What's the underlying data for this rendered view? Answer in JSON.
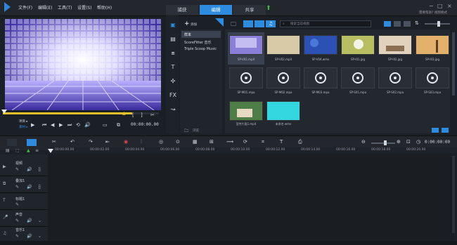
{
  "menu": {
    "file": "文件(F)",
    "edit": "编辑(E)",
    "tools": "工具(T)",
    "settings": "设置(S)",
    "help": "帮助(H)"
  },
  "tabs": [
    "捕获",
    "编辑",
    "共享"
  ],
  "window_info": "需要帮助? 视频格式",
  "preview": {
    "project_label": "项目 ▸",
    "clip_label": "素材 ▸",
    "timecode": "00:00:00.00"
  },
  "library": {
    "add_label": "添加",
    "search_placeholder": "搜索当前视图",
    "categories": [
      "样本",
      "ScoreFitter 音乐",
      "Triple Scoop Music"
    ],
    "browse_label": "浏览",
    "video_thumbs": [
      {
        "caption": "SP-V01.mp4",
        "color": "#8a7fd9"
      },
      {
        "caption": "SP-V02.mp4",
        "color": "#d8c9a7"
      },
      {
        "caption": "SP-V04.wmv",
        "color": "#2b51b5"
      },
      {
        "caption": "SP-I01.jpg",
        "color": "#b7bf62"
      },
      {
        "caption": "SP-I02.jpg",
        "color": "#e0d2bc"
      },
      {
        "caption": "SP-I03.jpg",
        "color": "#e3b16b"
      }
    ],
    "audio_thumbs": [
      "SP-M01.mpa",
      "SP-M02.mpa",
      "SP-M03.mpa",
      "SP-S01.mpa",
      "SP-S02.mpa",
      "SP-S03.mpa"
    ],
    "extra_thumbs": [
      {
        "caption": "宣传片段1.mp4",
        "color": "#4f7d47"
      },
      {
        "caption": "未命名.wmv",
        "color": "#34d7e0"
      }
    ]
  },
  "timeline": {
    "timecode": "0:00:00:00",
    "ruler": [
      "00:00:00.00",
      "00:00:02.00",
      "00:00:04.00",
      "00:00:06.00",
      "00:00:08.00",
      "00:00:10.00",
      "00:00:12.00",
      "00:00:14.00",
      "00:00:16.00",
      "00:00:18.00",
      "00:00:20.00"
    ],
    "tracks": [
      "视频",
      "叠加1",
      "标题1",
      "声音",
      "音乐1"
    ]
  },
  "colors": {
    "accent": "#2d8be0",
    "play_green": "#3bbf4a",
    "marker_yellow": "#e6c12a"
  }
}
